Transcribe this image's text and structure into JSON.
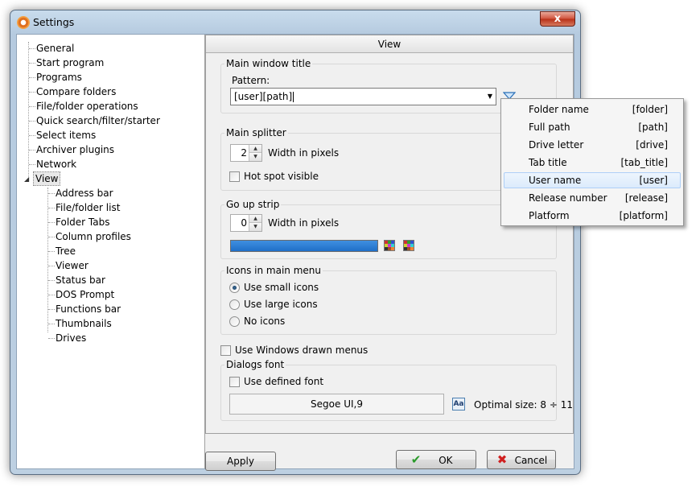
{
  "window": {
    "title": "Settings",
    "close_glyph": "x"
  },
  "tree": {
    "items": [
      {
        "label": "General"
      },
      {
        "label": "Start program"
      },
      {
        "label": "Programs"
      },
      {
        "label": "Compare folders"
      },
      {
        "label": "File/folder operations"
      },
      {
        "label": "Quick search/filter/starter"
      },
      {
        "label": "Select items"
      },
      {
        "label": "Archiver plugins"
      },
      {
        "label": "Network"
      },
      {
        "label": "View"
      }
    ],
    "expander_glyph": "◢",
    "children": [
      {
        "label": "Address bar"
      },
      {
        "label": "File/folder list"
      },
      {
        "label": "Folder Tabs"
      },
      {
        "label": "Column profiles"
      },
      {
        "label": "Tree"
      },
      {
        "label": "Viewer"
      },
      {
        "label": "Status bar"
      },
      {
        "label": "DOS Prompt"
      },
      {
        "label": "Functions bar"
      },
      {
        "label": "Thumbnails"
      },
      {
        "label": "Drives"
      }
    ]
  },
  "panel": {
    "header": "View",
    "main_window_title": {
      "group_label": "Main window title",
      "pattern_label": "Pattern:",
      "pattern_value": "[user][path]",
      "combo_arrow": "▼"
    },
    "main_splitter": {
      "group_label": "Main splitter",
      "width_value": "2",
      "width_label": "Width in pixels",
      "hotspot_label": "Hot spot visible",
      "spin_up": "▲",
      "spin_down": "▼"
    },
    "go_up_strip": {
      "group_label": "Go up strip",
      "width_value": "0",
      "width_label": "Width in pixels",
      "color": "#2878d8"
    },
    "icons_menu": {
      "group_label": "Icons in main menu",
      "options": [
        "Use small icons",
        "Use large icons",
        "No icons"
      ],
      "selected": 0
    },
    "windows_menus_label": "Use Windows drawn menus",
    "dialogs_font": {
      "group_label": "Dialogs font",
      "use_defined_label": "Use defined font",
      "font_value": "Segoe UI,9",
      "font_icon_text": "Aa",
      "optimal_size": "Optimal size: 8 ÷ 11"
    }
  },
  "buttons": {
    "apply": "Apply",
    "ok": "OK",
    "ok_glyph": "✔",
    "cancel": "Cancel",
    "cancel_glyph": "✖"
  },
  "popup": {
    "items": [
      {
        "label": "Folder name",
        "tag": "[folder]"
      },
      {
        "label": "Full path",
        "tag": "[path]"
      },
      {
        "label": "Drive letter",
        "tag": "[drive]"
      },
      {
        "label": "Tab title",
        "tag": "[tab_title]"
      },
      {
        "label": "User name",
        "tag": "[user]"
      },
      {
        "label": "Release number",
        "tag": "[release]"
      },
      {
        "label": "Platform",
        "tag": "[platform]"
      }
    ],
    "highlighted": 4
  },
  "colors": {
    "accent": "#2878d8",
    "selection": "#dcebfc"
  }
}
